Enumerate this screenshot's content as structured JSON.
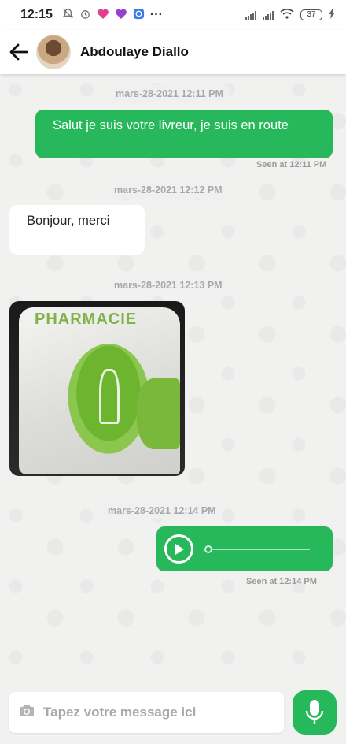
{
  "status_bar": {
    "time": "12:15",
    "notification_icons": [
      "bell-off-icon",
      "alarm-icon",
      "heart-app-icon",
      "heart-app-icon",
      "app-icon"
    ],
    "more": "···",
    "battery": "37"
  },
  "header": {
    "contact_name": "Abdoulaye Diallo"
  },
  "messages": [
    {
      "timestamp": "mars-28-2021 12:11 PM",
      "direction": "out",
      "type": "text",
      "text": "Salut je suis votre livreur, je suis en route",
      "seen": "Seen at 12:11 PM"
    },
    {
      "timestamp": "mars-28-2021 12:12 PM",
      "direction": "in",
      "type": "text",
      "text": "Bonjour, merci"
    },
    {
      "timestamp": "mars-28-2021 12:13 PM",
      "direction": "in",
      "type": "image",
      "image_text": "PHARMACIE"
    },
    {
      "timestamp": "mars-28-2021 12:14 PM",
      "direction": "out",
      "type": "audio",
      "seen": "Seen at 12:14 PM"
    }
  ],
  "composer": {
    "placeholder": "Tapez votre message ici"
  },
  "colors": {
    "accent": "#26b85a",
    "background": "#f1f2f0"
  }
}
